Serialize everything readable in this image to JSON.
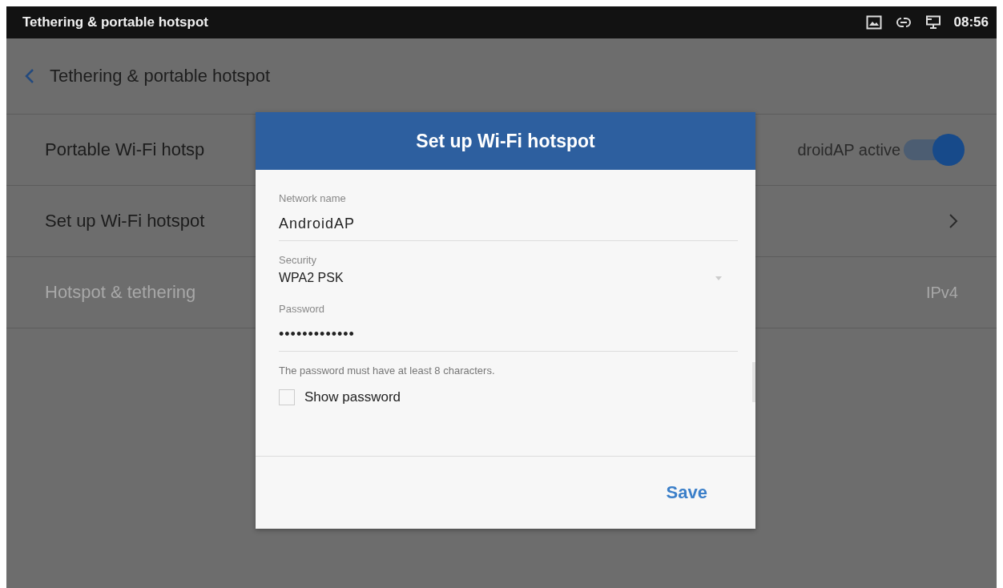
{
  "status_bar": {
    "title": "Tethering & portable hotspot",
    "time": "08:56"
  },
  "action_bar": {
    "title": "Tethering & portable hotspot"
  },
  "settings": [
    {
      "kind": "switch",
      "label": "Portable Wi-Fi hotsp",
      "summary": "droidAP active",
      "on": true,
      "disabled": false
    },
    {
      "kind": "chevron",
      "label": "Set up Wi-Fi hotspot",
      "disabled": false
    },
    {
      "kind": "value",
      "label": "Hotspot & tethering",
      "value": "IPv4",
      "disabled": true
    }
  ],
  "dialog": {
    "title": "Set up Wi-Fi hotspot",
    "fields": [
      {
        "kind": "text",
        "label": "Network name",
        "value": "AndroidAP"
      },
      {
        "kind": "dropdown",
        "label": "Security",
        "value": "WPA2 PSK"
      },
      {
        "kind": "text",
        "label": "Password",
        "value": "•••••••••••••"
      }
    ],
    "hint": "The password must have at least 8 characters.",
    "show_password": {
      "label": "Show password",
      "checked": false
    },
    "buttons": [
      "Save"
    ]
  }
}
